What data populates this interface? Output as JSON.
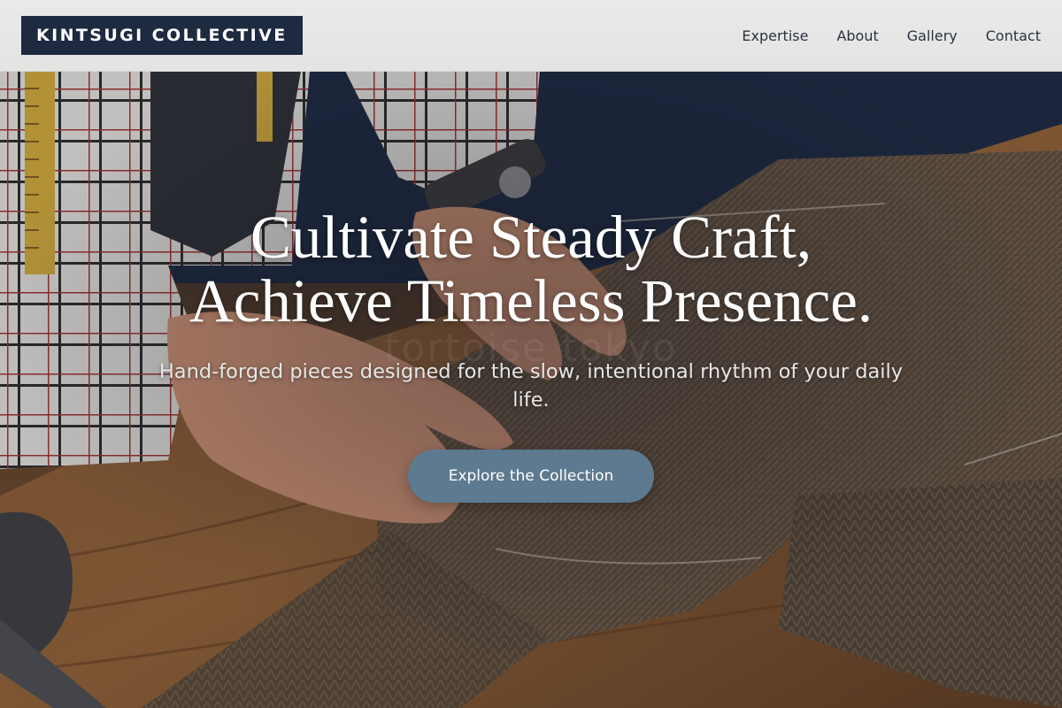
{
  "header": {
    "brand": "KINTSUGI COLLECTIVE",
    "nav": [
      {
        "label": "Expertise"
      },
      {
        "label": "About"
      },
      {
        "label": "Gallery"
      },
      {
        "label": "Contact"
      }
    ]
  },
  "hero": {
    "headline_line1": "Cultivate Steady Craft,",
    "headline_line2": "Achieve Timeless Presence.",
    "subheadline": "Hand-forged pieces designed for the slow, intentional rhythm of your daily life.",
    "cta_label": "Explore the Collection",
    "watermark": "tortoise tokyo",
    "background_image": "tailor-cutting-tweed-fabric"
  },
  "colors": {
    "brand_bg": "#1d2a40",
    "cta_bg": "#5d7a90",
    "header_bg": "#eeeeec",
    "nav_text": "#2b3240"
  }
}
